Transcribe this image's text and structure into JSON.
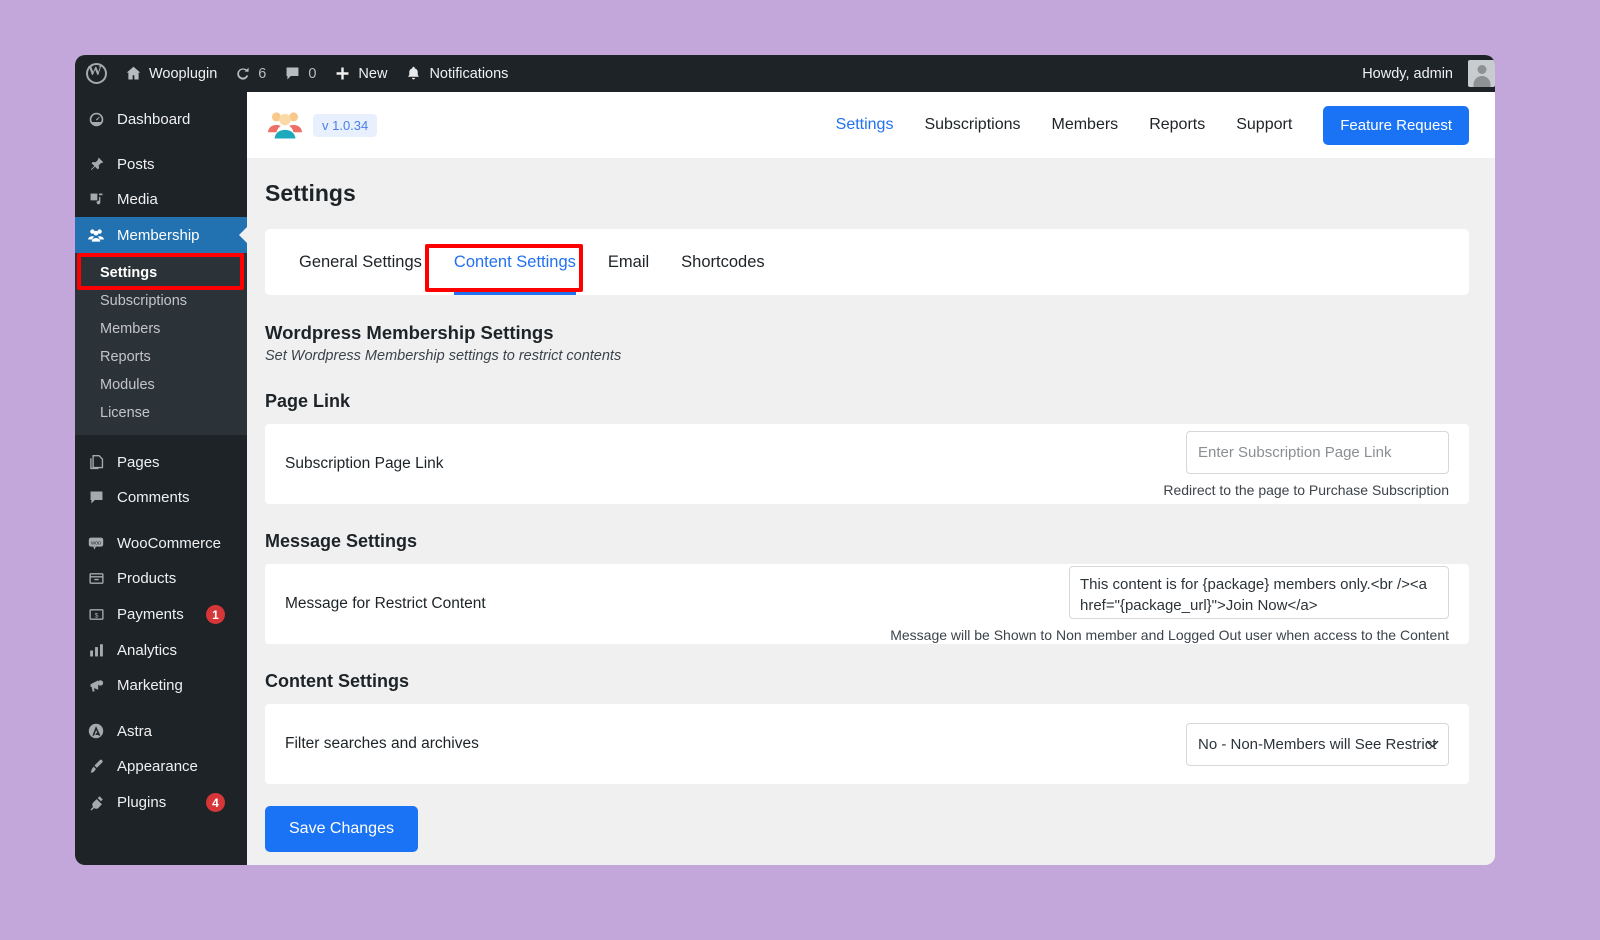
{
  "adminbar": {
    "wp_logo": "wordpress-logo",
    "site_name": "Wooplugin",
    "updates_count": "6",
    "comments_count": "0",
    "new_label": "New",
    "notifications_label": "Notifications",
    "howdy": "Howdy, admin"
  },
  "sidebar": {
    "items": [
      {
        "label": "Dashboard",
        "icon": "dashboard-icon",
        "badge": ""
      },
      {
        "label": "Posts",
        "icon": "pin-icon",
        "badge": ""
      },
      {
        "label": "Media",
        "icon": "media-icon",
        "badge": ""
      },
      {
        "label": "Membership",
        "icon": "users-icon",
        "badge": "",
        "active": true
      },
      {
        "label": "Pages",
        "icon": "pages-icon",
        "badge": ""
      },
      {
        "label": "Comments",
        "icon": "comment-icon",
        "badge": ""
      },
      {
        "label": "WooCommerce",
        "icon": "woo-icon",
        "badge": ""
      },
      {
        "label": "Products",
        "icon": "products-icon",
        "badge": ""
      },
      {
        "label": "Payments",
        "icon": "payments-icon",
        "badge": "1"
      },
      {
        "label": "Analytics",
        "icon": "analytics-icon",
        "badge": ""
      },
      {
        "label": "Marketing",
        "icon": "megaphone-icon",
        "badge": ""
      },
      {
        "label": "Astra",
        "icon": "astra-icon",
        "badge": ""
      },
      {
        "label": "Appearance",
        "icon": "brush-icon",
        "badge": ""
      },
      {
        "label": "Plugins",
        "icon": "plug-icon",
        "badge": "4"
      }
    ],
    "submenu": [
      {
        "label": "Settings",
        "current": true
      },
      {
        "label": "Subscriptions",
        "current": false
      },
      {
        "label": "Members",
        "current": false
      },
      {
        "label": "Reports",
        "current": false
      },
      {
        "label": "Modules",
        "current": false
      },
      {
        "label": "License",
        "current": false
      }
    ]
  },
  "plugin_header": {
    "logo": "group-of-people-icon",
    "version": "v 1.0.34",
    "nav": [
      {
        "label": "Settings",
        "active": true
      },
      {
        "label": "Subscriptions",
        "active": false
      },
      {
        "label": "Members",
        "active": false
      },
      {
        "label": "Reports",
        "active": false
      },
      {
        "label": "Support",
        "active": false
      }
    ],
    "feature_request": "Feature Request"
  },
  "page": {
    "title": "Settings",
    "tabs": [
      {
        "label": "General Settings",
        "active": false
      },
      {
        "label": "Content Settings",
        "active": true
      },
      {
        "label": "Email",
        "active": false
      },
      {
        "label": "Shortcodes",
        "active": false
      }
    ],
    "section_title": "Wordpress Membership Settings",
    "section_sub": "Set Wordpress Membership settings to restrict contents",
    "groups": {
      "page_link": {
        "title": "Page Link",
        "field_label": "Subscription Page Link",
        "input_value": "",
        "input_placeholder": "Enter Subscription Page Link",
        "hint": "Redirect to the page to Purchase Subscription"
      },
      "message_settings": {
        "title": "Message Settings",
        "field_label": "Message for Restrict Content",
        "textarea_value": "This content is for {package} members only.<br /><a href=\"{package_url}\">Join Now</a>",
        "hint": "Message will be Shown to Non member and Logged Out user when access to the Content"
      },
      "content_settings": {
        "title": "Content Settings",
        "field_label": "Filter searches and archives",
        "select_value": "No - Non-Members will See Restrict",
        "caret": "chevron-down-icon"
      }
    },
    "save_label": "Save Changes"
  },
  "colors": {
    "accent_blue": "#1a73f5",
    "link_blue": "#2271f1",
    "wp_blue": "#2271b1",
    "admin_dark": "#1d2327",
    "submenu_dark": "#2c3338",
    "badge_red": "#d63638",
    "highlight_red": "#ff0000",
    "page_bg": "#f0f0f1",
    "desktop_bg": "#c3a6da"
  }
}
